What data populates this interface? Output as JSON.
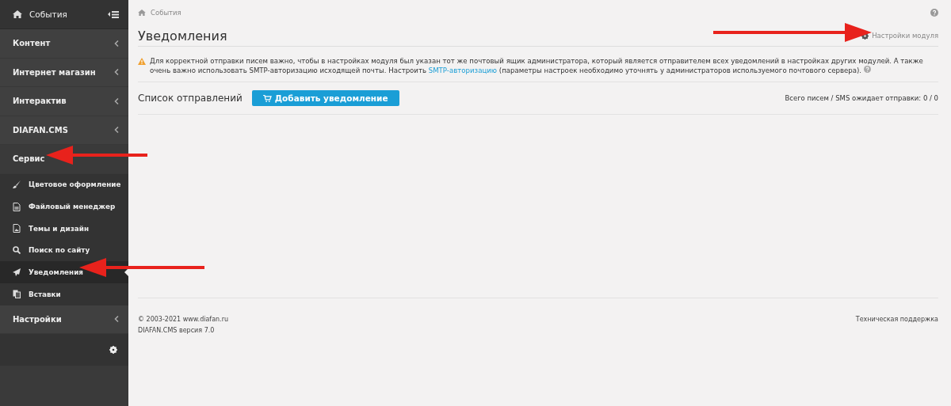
{
  "sidebar": {
    "header": {
      "label": "События"
    },
    "sections": [
      {
        "label": "Контент",
        "expanded": false
      },
      {
        "label": "Интернет магазин",
        "expanded": false
      },
      {
        "label": "Интерактив",
        "expanded": false
      },
      {
        "label": "DIAFAN.CMS",
        "expanded": false
      },
      {
        "label": "Сервис",
        "expanded": true,
        "children": [
          {
            "label": "Цветовое оформление",
            "selected": false
          },
          {
            "label": "Файловый менеджер",
            "selected": false
          },
          {
            "label": "Темы и дизайн",
            "selected": false
          },
          {
            "label": "Поиск по сайту",
            "selected": false
          },
          {
            "label": "Уведомления",
            "selected": true
          },
          {
            "label": "Вставки",
            "selected": false
          }
        ]
      },
      {
        "label": "Настройки",
        "expanded": false
      }
    ]
  },
  "breadcrumb": "События",
  "title": "Уведомления",
  "module_settings": "Настройки модуля",
  "notice": {
    "before": "Для корректной отправки писем важно, чтобы в настройках модуля был указан тот же почтовый ящик администратора, который является отправителем всех уведомлений в настройках других модулей. А также очень важно использовать SMTP-авторизацию исходящей почты. Настроить ",
    "link": "SMTP-авторизацию",
    "after": " (параметры настроек необходимо уточнять у администраторов используемого почтового сервера)."
  },
  "list": {
    "title": "Список отправлений",
    "add_button": "Добавить уведомление",
    "counter": "Всего писем / SMS ожидает отправки: 0 / 0"
  },
  "footer": {
    "copyright": "© 2003-2021 www.diafan.ru",
    "version": "DIAFAN.CMS версия 7.0",
    "support": "Техническая поддержка"
  }
}
